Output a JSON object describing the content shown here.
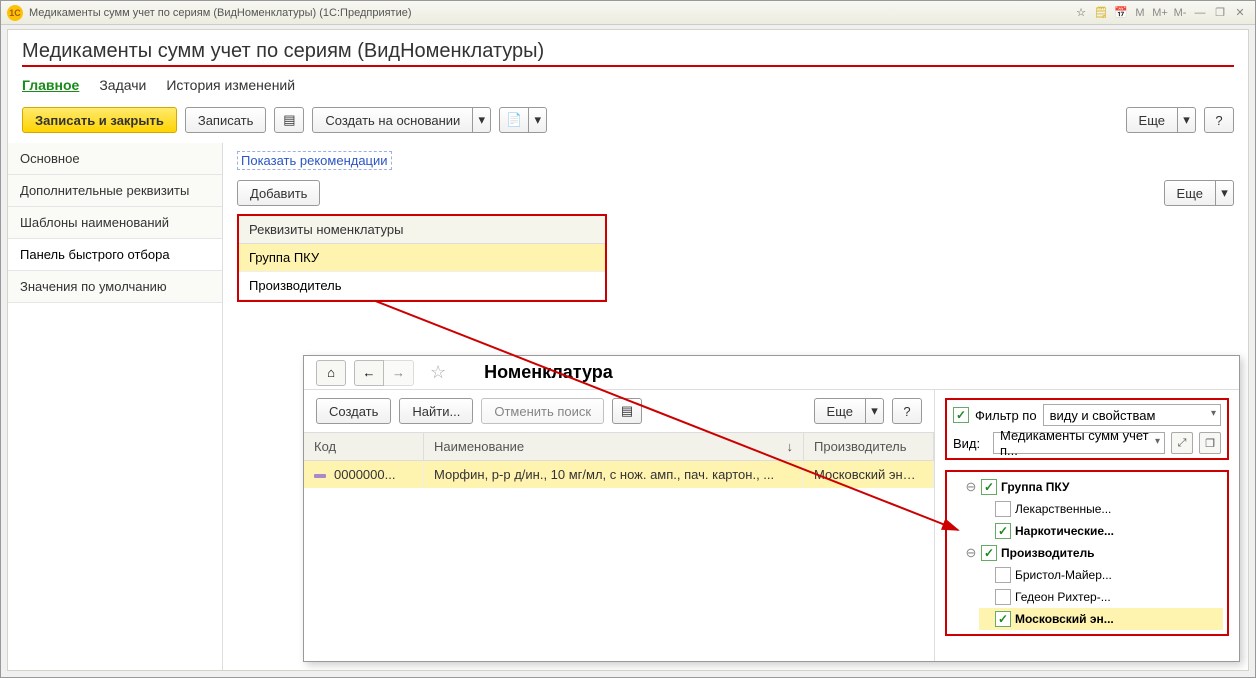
{
  "titlebar": {
    "title": "Медикаменты сумм учет по сериям (ВидНоменклатуры)  (1С:Предприятие)",
    "memory": [
      "M",
      "M+",
      "M-"
    ],
    "minimize": "—",
    "maximize": "❐",
    "close": "✕"
  },
  "page": {
    "title": "Медикаменты сумм учет по сериям (ВидНоменклатуры)"
  },
  "tabs": {
    "main": "Главное",
    "tasks": "Задачи",
    "history": "История изменений"
  },
  "toolbar": {
    "save_close": "Записать и закрыть",
    "save": "Записать",
    "create_based": "Создать на основании",
    "more": "Еще",
    "help": "?"
  },
  "sidenav": {
    "items": [
      "Основное",
      "Дополнительные реквизиты",
      "Шаблоны наименований",
      "Панель быстрого отбора",
      "Значения по умолчанию"
    ]
  },
  "rightpane": {
    "recommend_link": "Показать рекомендации",
    "add": "Добавить",
    "more": "Еще",
    "req_header": "Реквизиты номенклатуры",
    "req_rows": [
      "Группа ПКУ",
      "Производитель"
    ]
  },
  "inset": {
    "title": "Номенклатура",
    "toolbar": {
      "create": "Создать",
      "find": "Найти...",
      "cancel_find": "Отменить поиск",
      "more": "Еще",
      "help": "?"
    },
    "columns": {
      "code": "Код",
      "name": "Наименование",
      "prod": "Производитель"
    },
    "rows": [
      {
        "code": "0000000...",
        "name": "Морфин, р-р д/ин., 10 мг/мл, с нож. амп., пач. картон., ...",
        "prod": "Московский эндок..."
      }
    ],
    "filter": {
      "filter_by": "Фильтр по",
      "filter_val": "виду и свойствам",
      "kind_label": "Вид:",
      "kind_val": "Медикаменты сумм учет п..."
    },
    "tree": {
      "group_pku": "Группа ПКУ",
      "lek": "Лекарственные...",
      "nark": "Наркотические...",
      "producer": "Производитель",
      "bristol": "Бристол-Майер...",
      "gedeon": "Гедеон Рихтер-...",
      "moscow": "Московский эн..."
    }
  }
}
